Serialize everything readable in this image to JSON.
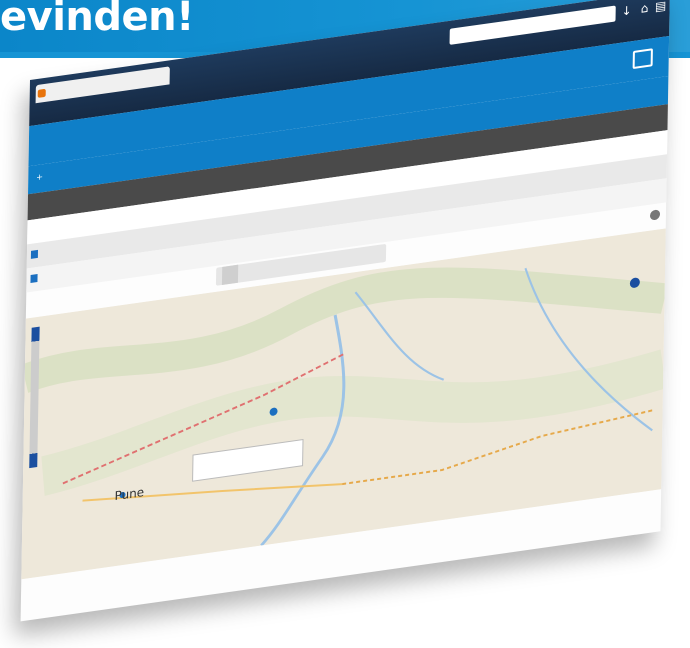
{
  "banner": {
    "title": "evinden!"
  },
  "browser": {
    "tab_title": "",
    "url": ""
  },
  "app_nav": {
    "links": [
      "",
      "",
      "",
      ""
    ]
  },
  "toolbar": {
    "tabs": [
      "",
      "",
      ""
    ]
  },
  "table": {
    "columns": [
      "",
      "",
      "",
      "",
      ""
    ],
    "rows": [
      {
        "cells": [
          "",
          "",
          ""
        ]
      },
      {
        "cells": [
          "",
          "",
          ""
        ]
      }
    ]
  },
  "view_tabs": [
    "",
    "",
    ""
  ],
  "map": {
    "labels": [
      "Pune",
      ""
    ],
    "footer": ""
  },
  "colors": {
    "brand": "#1694d4",
    "nav": "#0f7fc8",
    "header": "#4a4a4a"
  },
  "icons": [
    "chat-icon",
    "download-icon",
    "home-icon",
    "plus-icon",
    "refresh-icon",
    "map-pin-icon",
    "zoom-control-icon",
    "pan-control-icon"
  ]
}
